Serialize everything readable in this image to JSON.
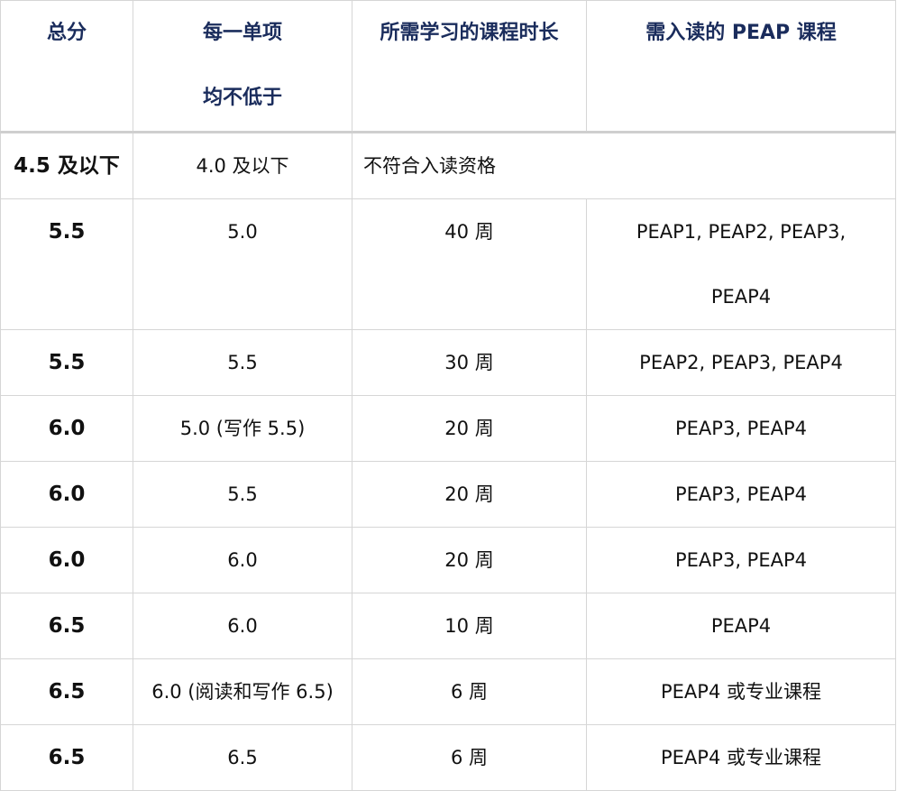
{
  "headers": {
    "total": "总分",
    "each_line1": "每一单项",
    "each_line2": "均不低于",
    "duration": "所需学习的课程时长",
    "courses": "需入读的 PEAP 课程"
  },
  "rows": [
    {
      "total": "4.5 及以下",
      "each": "4.0 及以下",
      "note": "不符合入读资格"
    },
    {
      "total": "5.5",
      "each": "5.0",
      "duration": "40 周",
      "courses_line1": "PEAP1, PEAP2, PEAP3,",
      "courses_line2": "PEAP4"
    },
    {
      "total": "5.5",
      "each": "5.5",
      "duration": "30 周",
      "courses": "PEAP2, PEAP3, PEAP4"
    },
    {
      "total": "6.0",
      "each": "5.0 (写作 5.5)",
      "duration": "20 周",
      "courses": "PEAP3, PEAP4"
    },
    {
      "total": "6.0",
      "each": "5.5",
      "duration": "20 周",
      "courses": "PEAP3, PEAP4"
    },
    {
      "total": "6.0",
      "each": "6.0",
      "duration": "20 周",
      "courses": "PEAP3, PEAP4"
    },
    {
      "total": "6.5",
      "each": "6.0",
      "duration": "10 周",
      "courses": "PEAP4"
    },
    {
      "total": "6.5",
      "each": "6.0 (阅读和写作 6.5)",
      "duration": "6 周",
      "courses": "PEAP4 或专业课程"
    },
    {
      "total": "6.5",
      "each": "6.5",
      "duration": "6 周",
      "courses": "PEAP4 或专业课程"
    }
  ]
}
